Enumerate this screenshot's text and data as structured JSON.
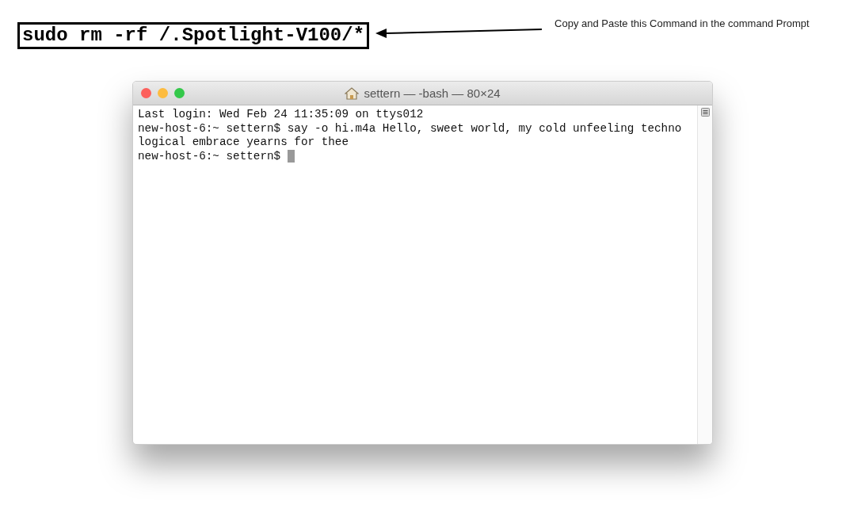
{
  "annotation": {
    "command": "sudo rm -rf /.Spotlight-V100/*",
    "note": "Copy and Paste this Command in the command Prompt"
  },
  "terminal": {
    "title": "settern — -bash — 80×24",
    "lines": [
      {
        "kind": "output",
        "text": "Last login: Wed Feb 24 11:35:09 on ttys012"
      },
      {
        "kind": "output",
        "text": "new-host-6:~ settern$ say -o hi.m4a Hello, sweet world, my cold unfeeling techno"
      },
      {
        "kind": "output",
        "text": "logical embrace yearns for thee"
      },
      {
        "kind": "prompt",
        "text": "new-host-6:~ settern$"
      }
    ]
  }
}
